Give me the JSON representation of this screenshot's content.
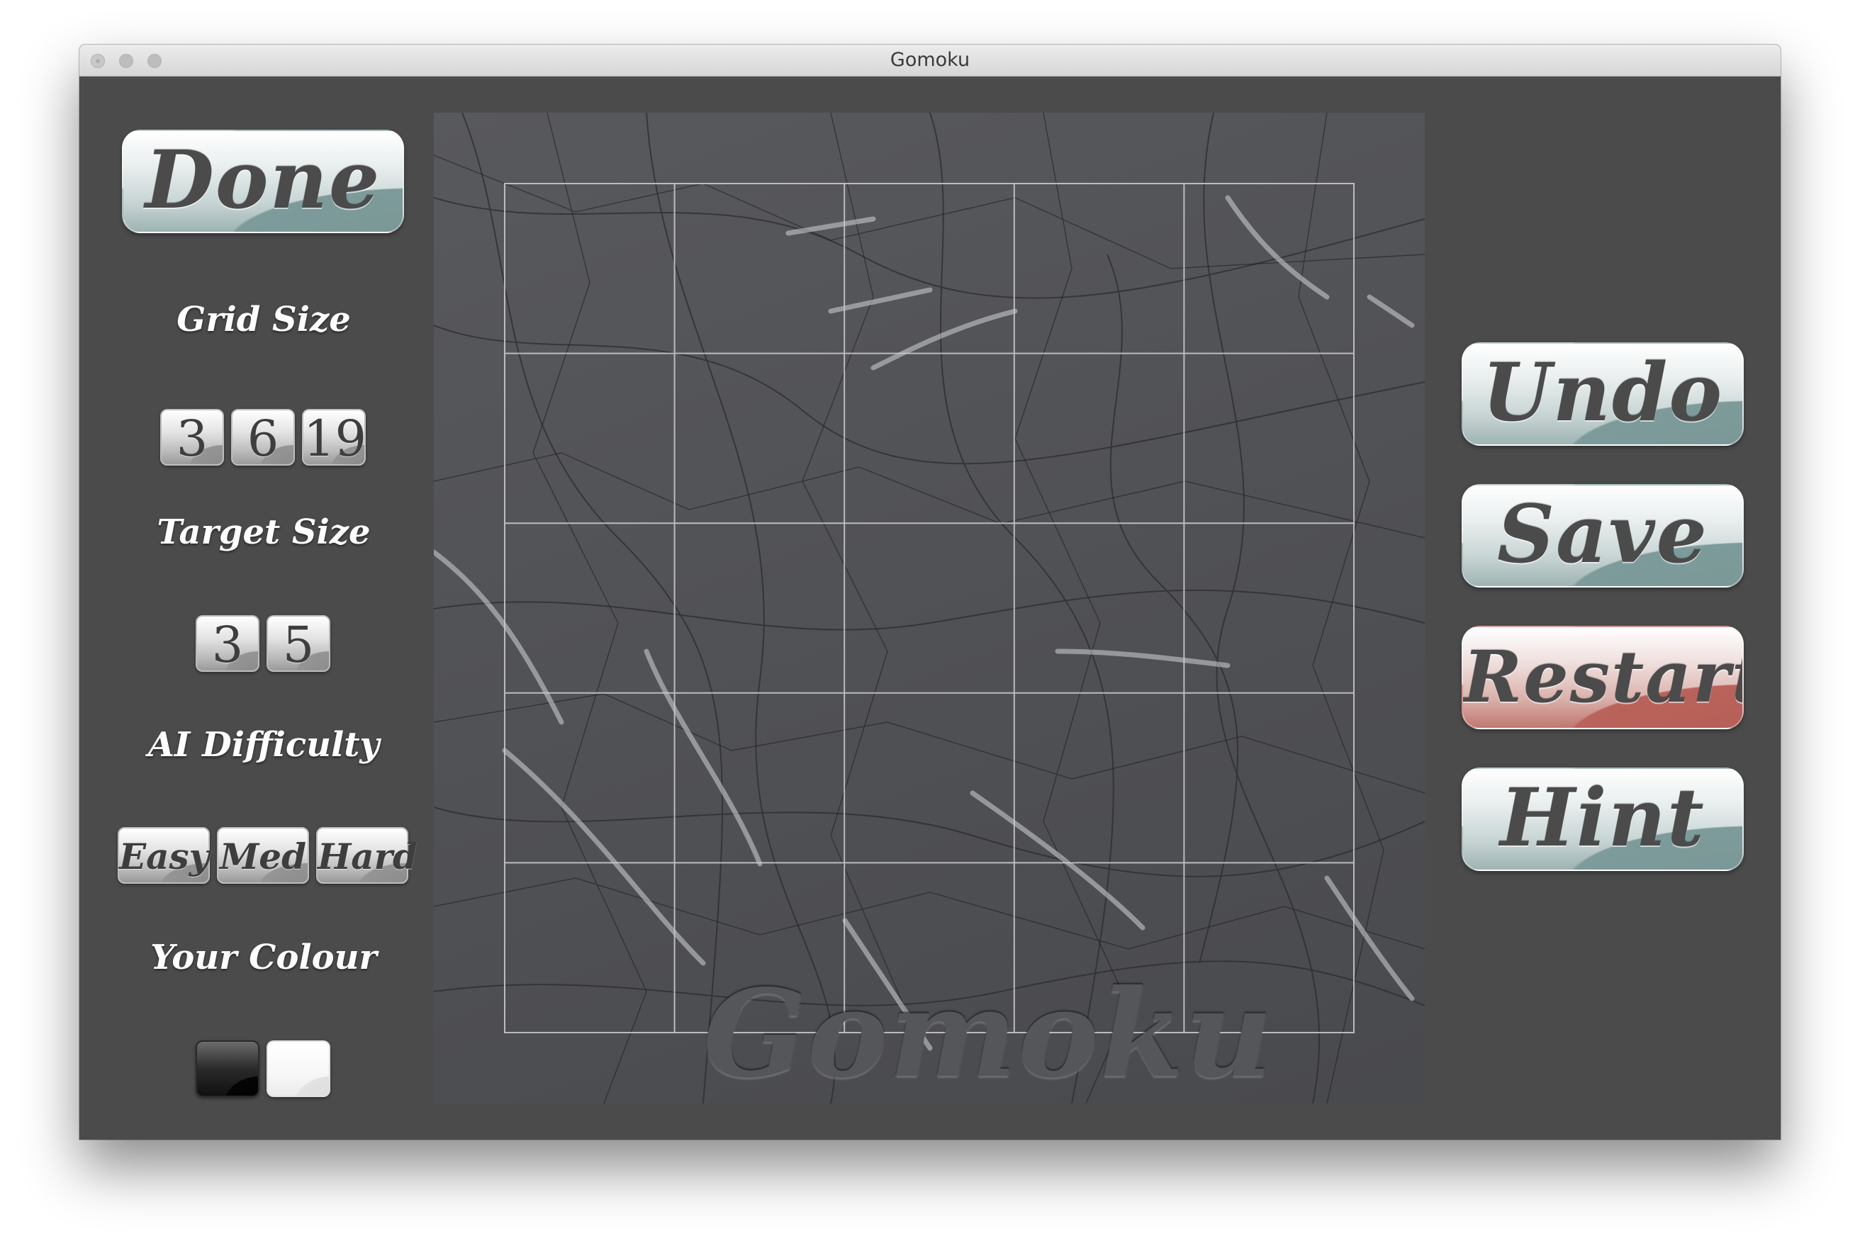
{
  "window": {
    "title": "Gomoku"
  },
  "left_panel": {
    "done_label": "Done",
    "grid_size": {
      "label": "Grid Size",
      "options": [
        "3",
        "6",
        "19"
      ]
    },
    "target_size": {
      "label": "Target Size",
      "options": [
        "3",
        "5"
      ]
    },
    "ai_difficulty": {
      "label": "AI Difficulty",
      "options": [
        "Easy",
        "Med",
        "Hard"
      ]
    },
    "your_colour": {
      "label": "Your Colour",
      "options": [
        "black",
        "white"
      ]
    }
  },
  "board": {
    "watermark": "Gomoku",
    "cells_per_side": 5
  },
  "right_panel": {
    "undo_label": "Undo",
    "save_label": "Save",
    "restart_label": "Restart",
    "hint_label": "Hint"
  },
  "colors": {
    "window_bg": "#4b4b4b",
    "button_teal": "#7d9b9a",
    "button_red": "#b9635b",
    "grid_line": "#c8c8c8"
  }
}
